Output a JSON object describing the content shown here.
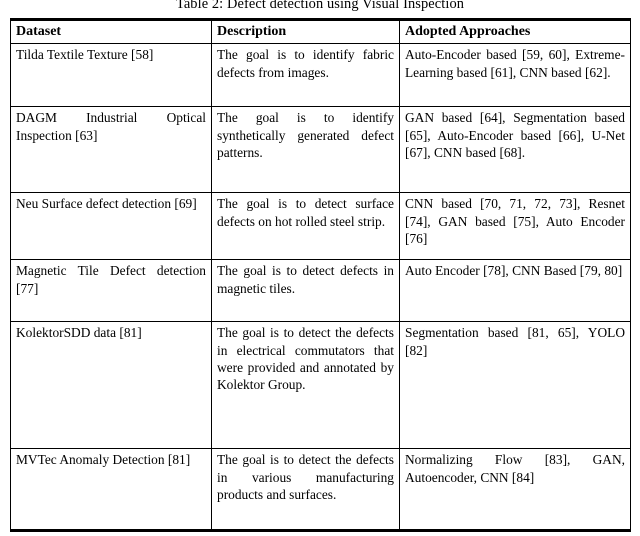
{
  "caption": "Table 2: Defect detection using Visual Inspection",
  "table": {
    "headers": {
      "dataset": "Dataset",
      "description": "Description",
      "approaches": "Adopted Approaches"
    },
    "rows": [
      {
        "dataset": "Tilda Textile Texture [58]",
        "description": "The goal is to identify fabric defects from images.",
        "approaches": "Auto-Encoder based [59, 60], Extreme-Learning based [61], CNN based [62]."
      },
      {
        "dataset": "DAGM Industrial Optical Inspection [63]",
        "description": "The goal is to identify synthetically generated defect patterns.",
        "approaches": "GAN based [64], Segmentation based [65], Auto-Encoder based [66], U-Net [67], CNN based [68]."
      },
      {
        "dataset": "Neu Surface defect detection [69]",
        "description": "The goal is to detect surface defects on hot rolled steel strip.",
        "approaches": "CNN based [70, 71, 72, 73], Resnet [74], GAN based [75], Auto Encoder [76]"
      },
      {
        "dataset": "Magnetic Tile Defect detection [77]",
        "description": "The goal is to detect defects in magnetic tiles.",
        "approaches": "Auto Encoder [78], CNN Based [79, 80]"
      },
      {
        "dataset": "KolektorSDD data [81]",
        "description": "The goal is to detect the defects in electrical commutators that were provided and annotated by Kolektor Group.",
        "approaches": "Segmentation based [81, 65], YOLO [82]"
      },
      {
        "dataset": "MVTec Anomaly Detection [81]",
        "description": "The goal is to detect the defects in various manufacturing products and surfaces.",
        "approaches": "Normalizing Flow [83], GAN, Autoencoder, CNN [84]"
      }
    ]
  }
}
